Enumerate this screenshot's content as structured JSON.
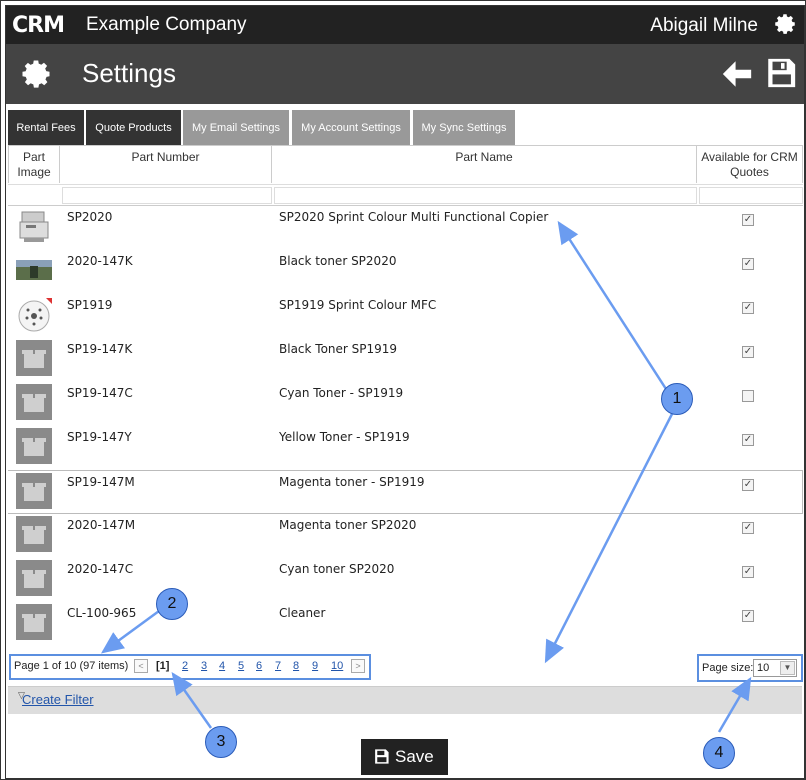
{
  "header": {
    "logo": "CRM",
    "company": "Example Company",
    "user": "Abigail Milne"
  },
  "page": {
    "title": "Settings"
  },
  "tabs": [
    {
      "label": "Rental Fees",
      "active": false
    },
    {
      "label": "Quote Products",
      "active": true
    },
    {
      "label": "My Email Settings",
      "active": false
    },
    {
      "label": "My Account Settings",
      "active": false
    },
    {
      "label": "My Sync Settings",
      "active": false
    }
  ],
  "grid": {
    "columns": {
      "image": "Part Image",
      "number": "Part Number",
      "name": "Part Name",
      "available": "Available for CRM Quotes"
    },
    "rows": [
      {
        "number": "SP2020",
        "name": "SP2020 Sprint Colour Multi Functional Copier",
        "checked": true,
        "icon": "copier"
      },
      {
        "number": "2020-147K",
        "name": "Black toner SP2020",
        "checked": true,
        "icon": "photo"
      },
      {
        "number": "SP1919",
        "name": "SP1919 Sprint Colour MFC",
        "checked": true,
        "icon": "dial"
      },
      {
        "number": "SP19-147K",
        "name": "Black Toner SP1919",
        "checked": true,
        "icon": "box"
      },
      {
        "number": "SP19-147C",
        "name": "Cyan Toner - SP1919",
        "checked": false,
        "icon": "box"
      },
      {
        "number": "SP19-147Y",
        "name": "Yellow Toner - SP1919",
        "checked": true,
        "icon": "box"
      },
      {
        "number": "SP19-147M",
        "name": "Magenta toner - SP1919",
        "checked": true,
        "icon": "box"
      },
      {
        "number": "2020-147M",
        "name": "Magenta toner SP2020",
        "checked": true,
        "icon": "box"
      },
      {
        "number": "2020-147C",
        "name": "Cyan toner SP2020",
        "checked": true,
        "icon": "box"
      },
      {
        "number": "CL-100-965",
        "name": "Cleaner",
        "checked": true,
        "icon": "box"
      }
    ]
  },
  "pager": {
    "info": "Page 1 of 10 (97 items)",
    "current": "[1]",
    "pages": [
      "2",
      "3",
      "4",
      "5",
      "6",
      "7",
      "8",
      "9",
      "10"
    ]
  },
  "pagesize": {
    "label": "Page size:",
    "value": "10"
  },
  "filter": {
    "link": "Create Filter"
  },
  "footer": {
    "save": "Save"
  },
  "callouts": [
    "1",
    "2",
    "3",
    "4"
  ],
  "colors": {
    "dark": "#222222",
    "title_bar": "#444444",
    "tab_inactive": "#999999",
    "link": "#2255aa",
    "callout": "#6b9cf0"
  }
}
